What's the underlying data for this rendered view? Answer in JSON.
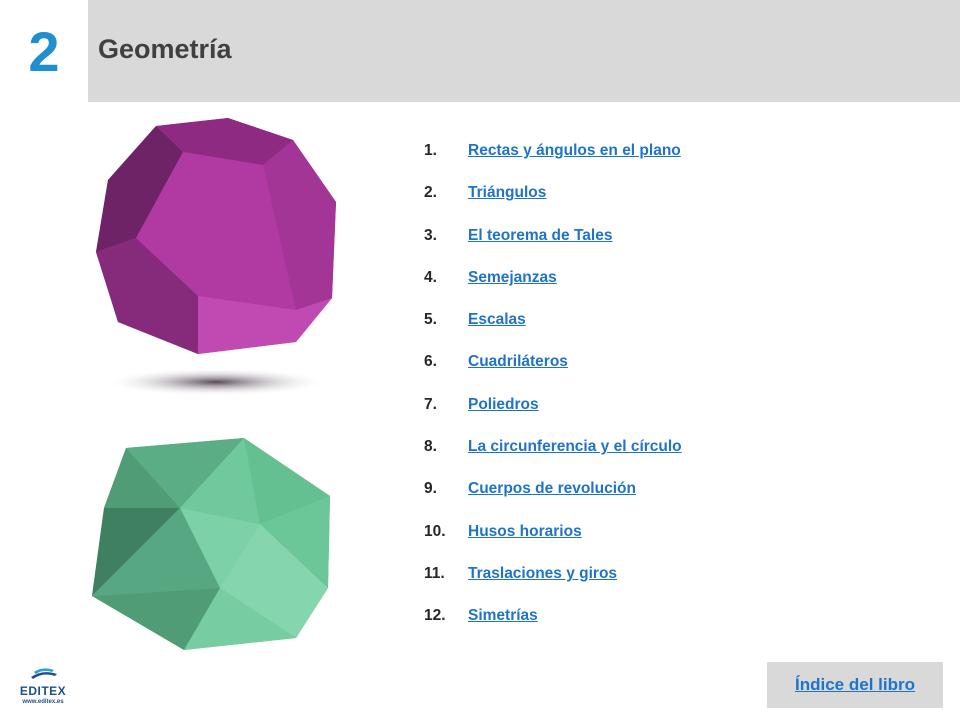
{
  "header": {
    "chapter_number": "2",
    "title": "Geometría"
  },
  "toc": [
    {
      "number": "1.",
      "label": "Rectas y ángulos en el plano"
    },
    {
      "number": "2.",
      "label": "Triángulos"
    },
    {
      "number": "3.",
      "label": "El teorema de Tales"
    },
    {
      "number": "4.",
      "label": "Semejanzas"
    },
    {
      "number": "5.",
      "label": "Escalas"
    },
    {
      "number": "6.",
      "label": "Cuadriláteros"
    },
    {
      "number": "7.",
      "label": "Poliedros"
    },
    {
      "number": "8.",
      "label": "La circunferencia y el círculo"
    },
    {
      "number": "9.",
      "label": "Cuerpos de revolución"
    },
    {
      "number": "10.",
      "label": "Husos horarios"
    },
    {
      "number": "11.",
      "label": "Traslaciones y giros"
    },
    {
      "number": "12.",
      "label": "Simetrías"
    }
  ],
  "footer": {
    "index_button_label": "Índice del libro",
    "logo_text": "EDITEX",
    "logo_url": "www.editex.es"
  },
  "colors": {
    "chapter_number": "#1f8fd0",
    "link": "#1f73c8",
    "header_bg": "#d9d9d9",
    "dodecahedron": "#a8349a",
    "icosahedron": "#5cb88a"
  }
}
